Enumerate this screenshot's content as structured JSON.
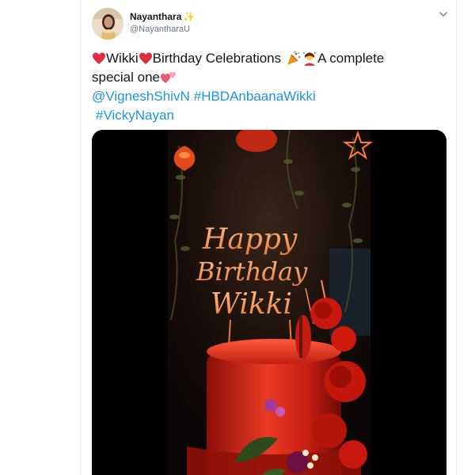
{
  "tweet": {
    "author": {
      "display_name": "Nayanthara",
      "handle": "@NayantharaU",
      "badge_icon": "sparkles-icon"
    },
    "text": {
      "name": "Wikki",
      "celebration": "Birthday Celebrations",
      "complete": "A complete",
      "special": "special one",
      "mention": "@VigneshShivN",
      "hashtag1": "#HBDAnbaanaWikki",
      "hashtag2": "#VickyNayan"
    },
    "media": {
      "cake_topper": {
        "line1": "Happy",
        "line2": "Birthday",
        "line3": "Wikki"
      }
    }
  },
  "colors": {
    "link": "#1b95e0",
    "heart": "#e0245e",
    "text": "#14171a",
    "muted": "#657786"
  }
}
